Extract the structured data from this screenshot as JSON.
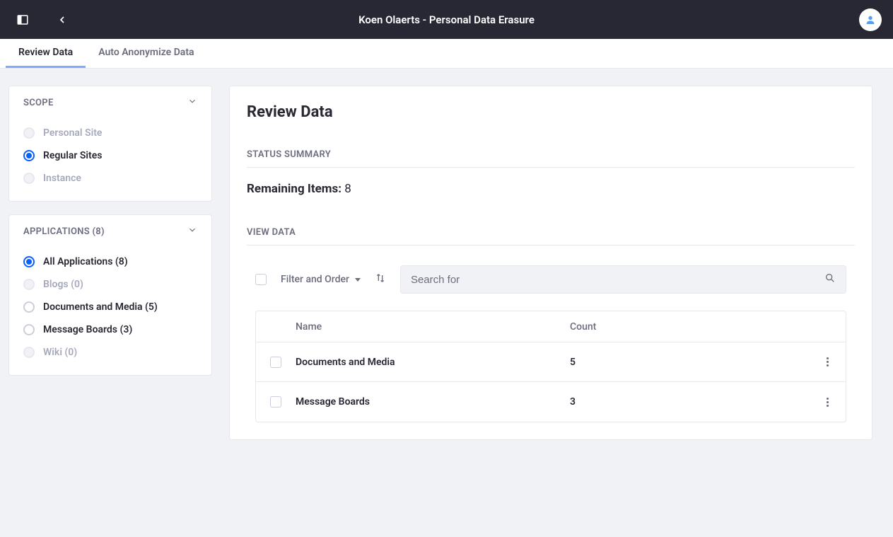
{
  "topbar": {
    "title": "Koen Olaerts - Personal Data Erasure"
  },
  "tabs": {
    "review_data": "Review Data",
    "auto_anonymize": "Auto Anonymize Data"
  },
  "scope": {
    "title": "SCOPE",
    "items": [
      {
        "label": "Personal Site",
        "selected": false,
        "enabled": false
      },
      {
        "label": "Regular Sites",
        "selected": true,
        "enabled": true
      },
      {
        "label": "Instance",
        "selected": false,
        "enabled": false
      }
    ]
  },
  "applications": {
    "title": "APPLICATIONS (8)",
    "items": [
      {
        "label": "All Applications (8)",
        "selected": true,
        "enabled": true
      },
      {
        "label": "Blogs (0)",
        "selected": false,
        "enabled": false
      },
      {
        "label": "Documents and Media (5)",
        "selected": false,
        "enabled": true
      },
      {
        "label": "Message Boards (3)",
        "selected": false,
        "enabled": true
      },
      {
        "label": "Wiki (0)",
        "selected": false,
        "enabled": false
      }
    ]
  },
  "main": {
    "heading": "Review Data",
    "status_summary_title": "STATUS SUMMARY",
    "remaining_label": "Remaining Items:",
    "remaining_value": "8",
    "view_data_title": "VIEW DATA",
    "filter_label": "Filter and Order",
    "search_placeholder": "Search for",
    "columns": {
      "name": "Name",
      "count": "Count"
    },
    "rows": [
      {
        "name": "Documents and Media",
        "count": "5"
      },
      {
        "name": "Message Boards",
        "count": "3"
      }
    ]
  }
}
